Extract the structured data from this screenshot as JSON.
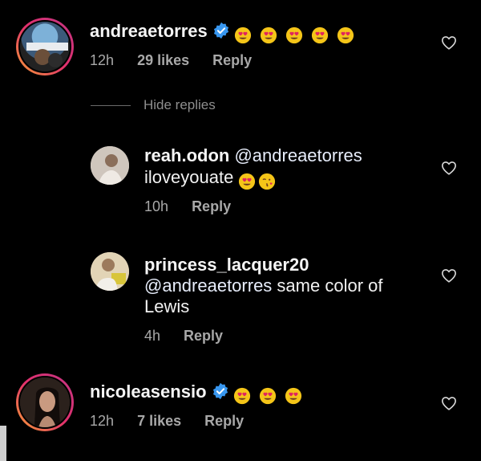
{
  "comments": [
    {
      "username": "andreaetorres",
      "verified": true,
      "emoji_count": 5,
      "time": "12h",
      "likes": "29 likes",
      "reply_label": "Reply",
      "avatar_icon": "user-avatar-andreaetorres"
    },
    {
      "username": "nicoleasensio",
      "verified": true,
      "emoji_count": 3,
      "time": "12h",
      "likes": "7 likes",
      "reply_label": "Reply",
      "avatar_icon": "user-avatar-nicoleasensio"
    }
  ],
  "hide_replies_label": "Hide replies",
  "replies": [
    {
      "username": "reah.odon",
      "mention": "@andreaetorres",
      "text_line2": "iloveyouate",
      "time": "10h",
      "reply_label": "Reply"
    },
    {
      "username": "princess_lacquer20",
      "mention": "@andreaetorres",
      "text_line2_tail": " same color of",
      "text_line3": "Lewis",
      "time": "4h",
      "reply_label": "Reply"
    }
  ],
  "colors": {
    "background": "#000000",
    "verified_badge": "#3897f0",
    "story_ring_start": "#f7a034",
    "story_ring_end": "#c13584",
    "meta_text": "#a8a8a8"
  },
  "icons": [
    "verified-badge-icon",
    "heart-eyes-emoji",
    "kiss-emoji",
    "heart-outline-icon"
  ]
}
